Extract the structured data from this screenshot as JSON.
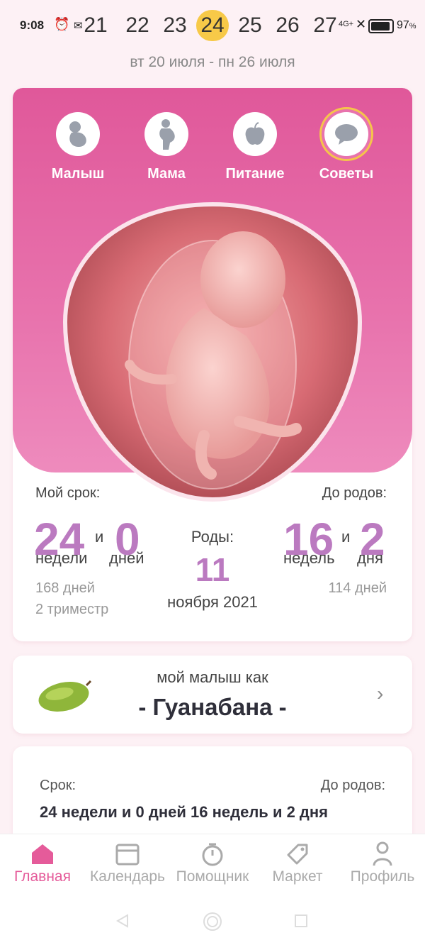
{
  "status_bar": {
    "time": "9:08",
    "battery": "97",
    "battery_unit": "%",
    "network": "4G+"
  },
  "week": {
    "days": [
      "21",
      "22",
      "23",
      "24",
      "25",
      "26",
      "27"
    ],
    "selected": "24",
    "range": "вт 20 июля - пн 26 июля"
  },
  "tabs": [
    {
      "label": "Малыш",
      "icon": "baby-icon"
    },
    {
      "label": "Мама",
      "icon": "mother-icon"
    },
    {
      "label": "Питание",
      "icon": "apple-icon"
    },
    {
      "label": "Советы",
      "icon": "chat-bubble-icon"
    }
  ],
  "selected_tab": "Советы",
  "stats": {
    "my_term_label": "Мой срок:",
    "weeks": "24",
    "and1": "и",
    "days": "0",
    "weeks_unit": "недели",
    "days_unit": "дней",
    "total_days": "168 дней",
    "trimester": "2 триместр",
    "birth_label": "Роды:",
    "birth_day": "11",
    "birth_month": "ноября 2021",
    "until_label": "До родов:",
    "until_weeks": "16",
    "and2": "и",
    "until_days": "2",
    "until_weeks_unit": "недель",
    "until_days_unit": "дня",
    "until_total": "114 дней"
  },
  "baby_size": {
    "caption": "мой малыш как",
    "fruit": "- Гуанабана -"
  },
  "details": {
    "term_label": "Срок:",
    "until_label": "До родов:",
    "summary": "24 недели и 0 дней 16 недель и 2 дня"
  },
  "nav": [
    {
      "label": "Главная",
      "icon": "home-icon"
    },
    {
      "label": "Календарь",
      "icon": "calendar-icon"
    },
    {
      "label": "Помощник",
      "icon": "timer-icon"
    },
    {
      "label": "Маркет",
      "icon": "tag-icon"
    },
    {
      "label": "Профиль",
      "icon": "profile-icon"
    }
  ],
  "colors": {
    "accent": "#e55b9a",
    "pink": "#e0589a",
    "purple": "#bb7ac0",
    "highlight": "#f7c948"
  }
}
